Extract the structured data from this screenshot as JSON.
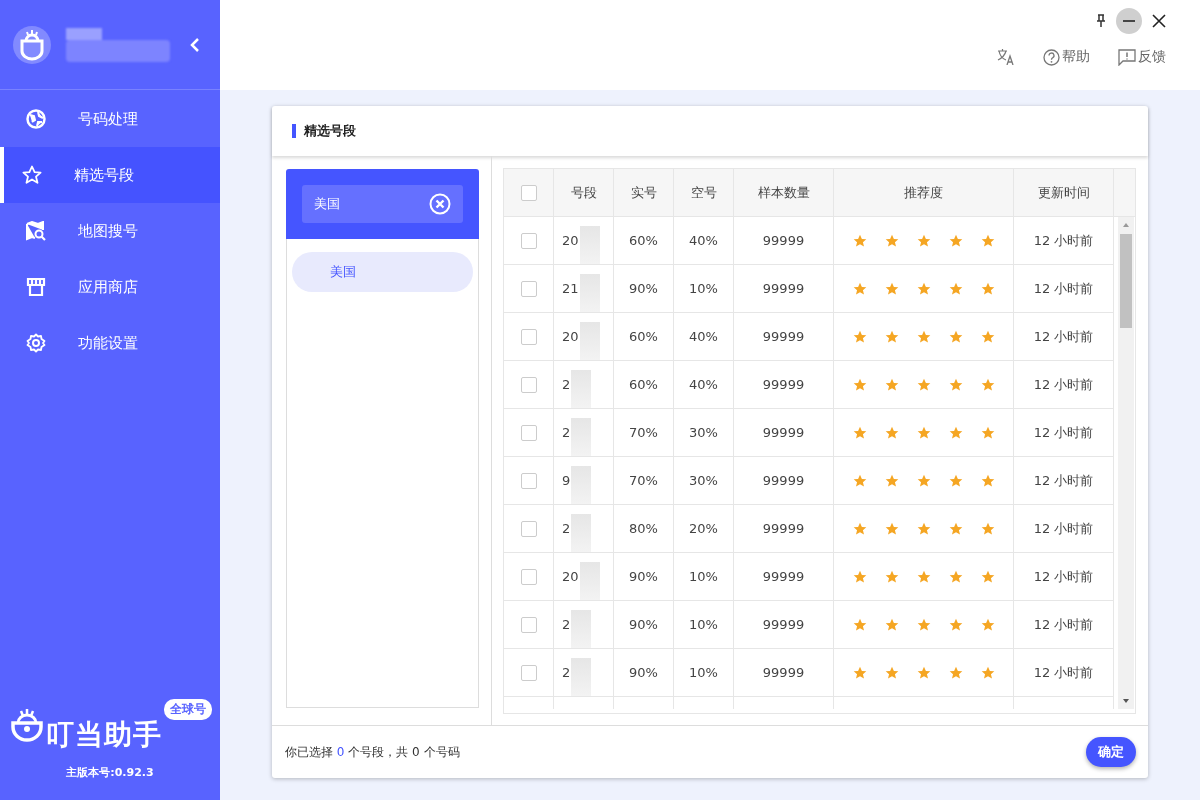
{
  "toolbar": [
    {
      "kind": "translate"
    },
    {
      "kind": "help",
      "label": "帮助"
    },
    {
      "kind": "feedback",
      "label": "反馈"
    }
  ],
  "sidebar": {
    "items": [
      {
        "label": "号码处理",
        "selected": false
      },
      {
        "label": "精选号段",
        "selected": true
      },
      {
        "label": "地图搜号",
        "selected": false
      },
      {
        "label": "应用商店",
        "selected": false
      },
      {
        "label": "功能设置",
        "selected": false
      }
    ],
    "brand": {
      "name": "叮当助手",
      "badge": "全球号",
      "version": "主版本号:0.92.3"
    }
  },
  "panel": {
    "title": "精选号段",
    "filter_chip": {
      "label": "美国"
    },
    "countries": [
      {
        "label": "美国",
        "selected": true
      }
    ],
    "table": {
      "columns": [
        "号段",
        "实号",
        "空号",
        "样本数量",
        "推荐度",
        "更新时间"
      ],
      "header_checked": false,
      "rows": [
        {
          "checked": false,
          "segment": "20",
          "real": "60%",
          "empty": "40%",
          "samples": "99999",
          "stars": 5,
          "updated": "12 小时前"
        },
        {
          "checked": false,
          "segment": "21",
          "real": "90%",
          "empty": "10%",
          "samples": "99999",
          "stars": 5,
          "updated": "12 小时前"
        },
        {
          "checked": false,
          "segment": "20",
          "real": "60%",
          "empty": "40%",
          "samples": "99999",
          "stars": 5,
          "updated": "12 小时前"
        },
        {
          "checked": false,
          "segment": "2",
          "real": "60%",
          "empty": "40%",
          "samples": "99999",
          "stars": 5,
          "updated": "12 小时前"
        },
        {
          "checked": false,
          "segment": "2",
          "real": "70%",
          "empty": "30%",
          "samples": "99999",
          "stars": 5,
          "updated": "12 小时前"
        },
        {
          "checked": false,
          "segment": "9",
          "real": "70%",
          "empty": "30%",
          "samples": "99999",
          "stars": 5,
          "updated": "12 小时前"
        },
        {
          "checked": false,
          "segment": "2",
          "real": "80%",
          "empty": "20%",
          "samples": "99999",
          "stars": 5,
          "updated": "12 小时前"
        },
        {
          "checked": false,
          "segment": "20",
          "real": "90%",
          "empty": "10%",
          "samples": "99999",
          "stars": 5,
          "updated": "12 小时前"
        },
        {
          "checked": false,
          "segment": "2",
          "real": "90%",
          "empty": "10%",
          "samples": "99999",
          "stars": 5,
          "updated": "12 小时前"
        },
        {
          "checked": false,
          "segment": "2",
          "real": "90%",
          "empty": "10%",
          "samples": "99999",
          "stars": 5,
          "updated": "12 小时前"
        }
      ]
    },
    "footer": {
      "prefix": "你已选择",
      "count": "0",
      "suffix": "个号段，共 0 个号码",
      "confirm": "确定"
    }
  }
}
